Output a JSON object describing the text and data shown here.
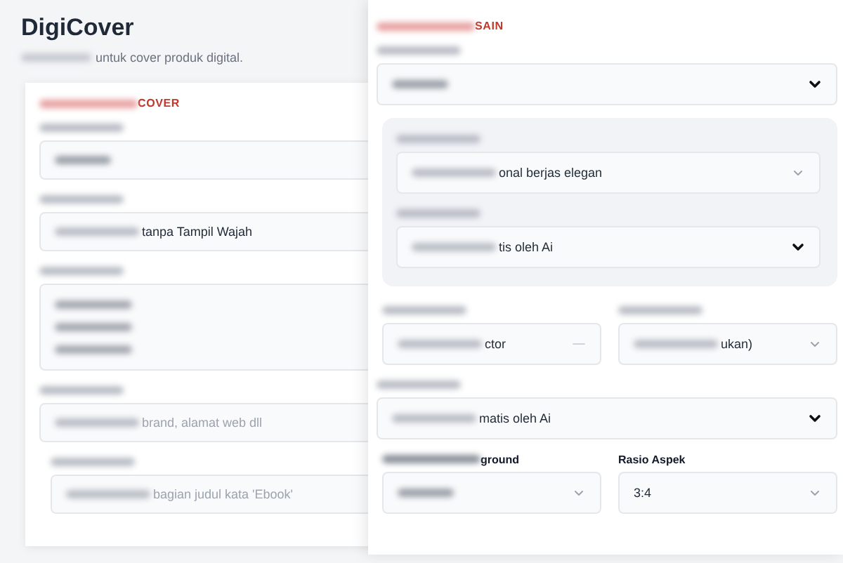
{
  "header": {
    "title": "DigiCover",
    "subtitle": "untuk cover produk digital.",
    "subtitle_obscured": true
  },
  "left_card": {
    "heading": "COVER",
    "heading_obscured": true,
    "fields": [
      {
        "kind": "input",
        "label_obscured": true,
        "value_obscured": true
      },
      {
        "kind": "input",
        "label_obscured": true,
        "value": "tanpa Tampil Wajah",
        "value_obscured": true
      },
      {
        "kind": "textarea",
        "label_obscured": true,
        "value_obscured": true
      },
      {
        "kind": "input",
        "label_obscured": true,
        "placeholder": "brand, alamat web dll",
        "value_obscured": true
      },
      {
        "kind": "input",
        "indent": true,
        "label_obscured": true,
        "placeholder": "bagian judul kata 'Ebook'",
        "value_obscured": true
      }
    ]
  },
  "right_card": {
    "heading": "SAIN",
    "heading_obscured": true,
    "rows": [
      {
        "kind": "single",
        "fields": [
          {
            "kind": "dark",
            "label_obscured": true,
            "value_obscured": true
          }
        ]
      },
      {
        "kind": "group",
        "fields": [
          {
            "kind": "light",
            "label_obscured": true,
            "value": "onal berjas elegan",
            "value_obscured": true
          },
          {
            "kind": "dark",
            "label_obscured": true,
            "value": "tis oleh Ai",
            "value_obscured": true
          }
        ]
      },
      {
        "kind": "pair",
        "fields": [
          {
            "kind": "dash",
            "label_obscured": true,
            "value": "ctor",
            "value_obscured": true
          },
          {
            "kind": "light",
            "label_obscured": true,
            "value": "ukan)",
            "value_obscured": true
          }
        ]
      },
      {
        "kind": "single",
        "fields": [
          {
            "kind": "dark",
            "label_obscured": true,
            "value": "matis oleh Ai",
            "value_obscured": true
          }
        ]
      },
      {
        "kind": "pair",
        "fields": [
          {
            "kind": "light",
            "label": "ground",
            "label_obscured": true,
            "value_obscured": true
          },
          {
            "kind": "light",
            "label": "Rasio Aspek",
            "value": "3:4"
          }
        ]
      }
    ]
  }
}
